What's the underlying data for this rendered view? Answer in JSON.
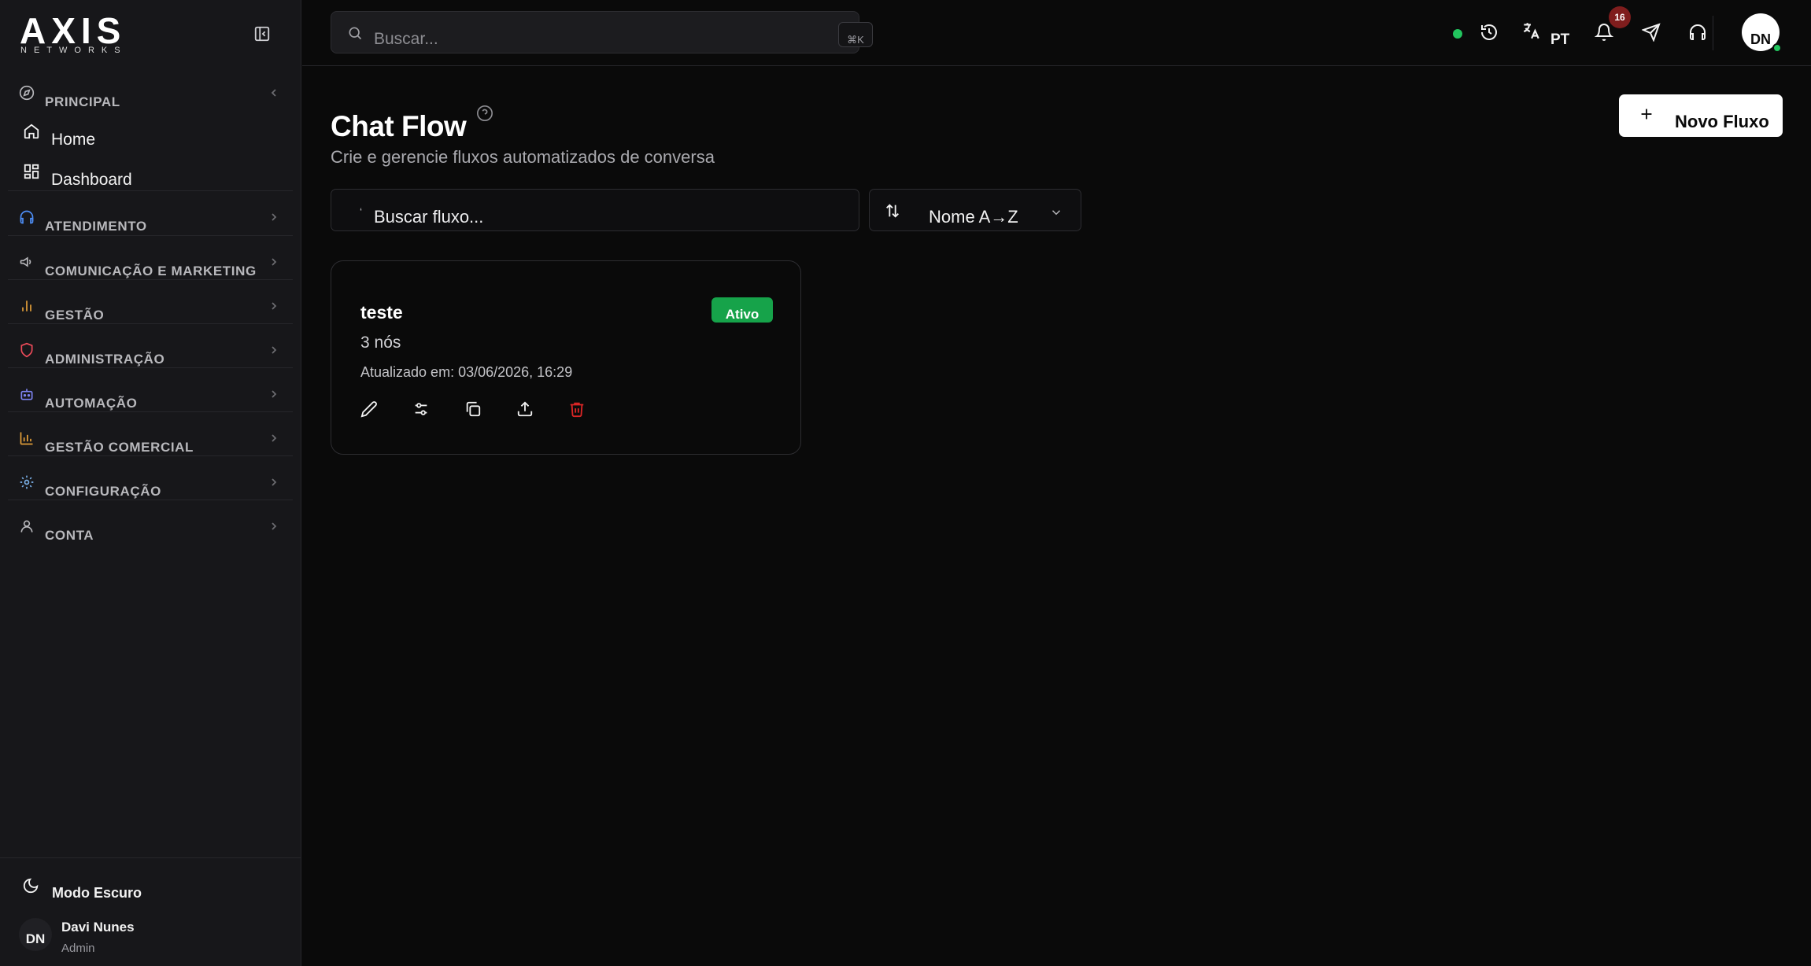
{
  "app": {
    "logo_main": "AXIS",
    "logo_sub": "NETWORKS"
  },
  "sidebar": {
    "sections": [
      {
        "label": "PRINCIPAL",
        "icon": "compass-icon"
      },
      {
        "label": "ATENDIMENTO",
        "icon": "headset-icon"
      },
      {
        "label": "COMUNICAÇÃO E MARKETING",
        "icon": "megaphone-icon"
      },
      {
        "label": "GESTÃO",
        "icon": "bar-chart-icon"
      },
      {
        "label": "ADMINISTRAÇÃO",
        "icon": "shield-icon"
      },
      {
        "label": "AUTOMAÇÃO",
        "icon": "bot-icon"
      },
      {
        "label": "GESTÃO COMERCIAL",
        "icon": "line-chart-icon"
      },
      {
        "label": "CONFIGURAÇÃO",
        "icon": "gear-icon"
      },
      {
        "label": "CONTA",
        "icon": "user-icon"
      }
    ],
    "principal_items": [
      {
        "label": "Home",
        "icon": "home-icon"
      },
      {
        "label": "Dashboard",
        "icon": "dashboard-icon"
      }
    ],
    "footer": {
      "dark_mode_label": "Modo Escuro",
      "user_initials": "DN",
      "user_name": "Davi Nunes",
      "user_role": "Admin"
    }
  },
  "topbar": {
    "search_placeholder": "Buscar...",
    "search_shortcut": "⌘K",
    "language": "PT",
    "notification_count": "16",
    "avatar_initials": "DN"
  },
  "main": {
    "title": "Chat Flow",
    "subtitle": "Crie e gerencie fluxos automatizados de conversa",
    "new_button_label": "Novo Fluxo",
    "flow_search_placeholder": "Buscar fluxo...",
    "sort_label": "Nome A→Z",
    "flows": [
      {
        "name": "teste",
        "status": "Ativo",
        "nodes": "3 nós",
        "updated": "Atualizado em: 03/06/2026, 16:29"
      }
    ]
  },
  "colors": {
    "accent_green": "#16a34a",
    "danger": "#dc2626",
    "badge_red": "#7f1d1d"
  }
}
